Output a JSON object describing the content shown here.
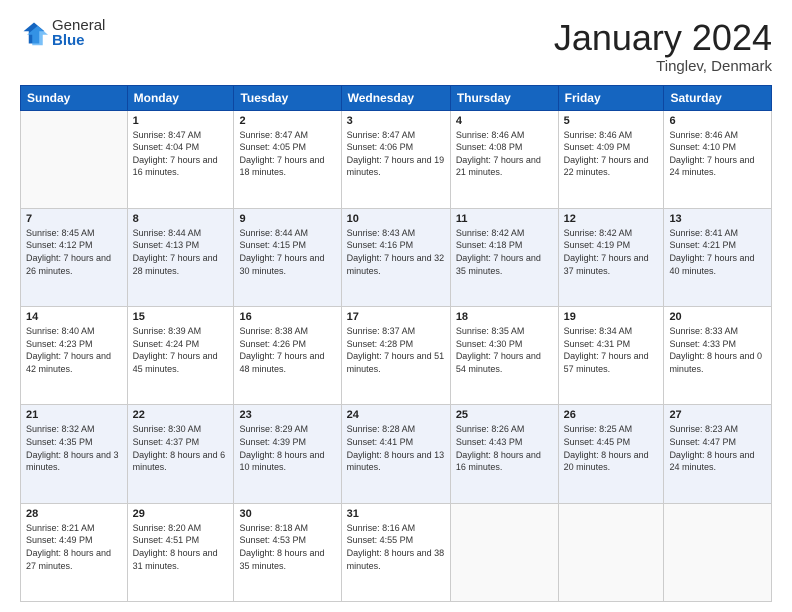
{
  "header": {
    "logo_general": "General",
    "logo_blue": "Blue",
    "title": "January 2024",
    "location": "Tinglev, Denmark"
  },
  "weekdays": [
    "Sunday",
    "Monday",
    "Tuesday",
    "Wednesday",
    "Thursday",
    "Friday",
    "Saturday"
  ],
  "weeks": [
    [
      {
        "day": null
      },
      {
        "day": 1,
        "sunrise": "Sunrise: 8:47 AM",
        "sunset": "Sunset: 4:04 PM",
        "daylight": "Daylight: 7 hours and 16 minutes."
      },
      {
        "day": 2,
        "sunrise": "Sunrise: 8:47 AM",
        "sunset": "Sunset: 4:05 PM",
        "daylight": "Daylight: 7 hours and 18 minutes."
      },
      {
        "day": 3,
        "sunrise": "Sunrise: 8:47 AM",
        "sunset": "Sunset: 4:06 PM",
        "daylight": "Daylight: 7 hours and 19 minutes."
      },
      {
        "day": 4,
        "sunrise": "Sunrise: 8:46 AM",
        "sunset": "Sunset: 4:08 PM",
        "daylight": "Daylight: 7 hours and 21 minutes."
      },
      {
        "day": 5,
        "sunrise": "Sunrise: 8:46 AM",
        "sunset": "Sunset: 4:09 PM",
        "daylight": "Daylight: 7 hours and 22 minutes."
      },
      {
        "day": 6,
        "sunrise": "Sunrise: 8:46 AM",
        "sunset": "Sunset: 4:10 PM",
        "daylight": "Daylight: 7 hours and 24 minutes."
      }
    ],
    [
      {
        "day": 7,
        "sunrise": "Sunrise: 8:45 AM",
        "sunset": "Sunset: 4:12 PM",
        "daylight": "Daylight: 7 hours and 26 minutes."
      },
      {
        "day": 8,
        "sunrise": "Sunrise: 8:44 AM",
        "sunset": "Sunset: 4:13 PM",
        "daylight": "Daylight: 7 hours and 28 minutes."
      },
      {
        "day": 9,
        "sunrise": "Sunrise: 8:44 AM",
        "sunset": "Sunset: 4:15 PM",
        "daylight": "Daylight: 7 hours and 30 minutes."
      },
      {
        "day": 10,
        "sunrise": "Sunrise: 8:43 AM",
        "sunset": "Sunset: 4:16 PM",
        "daylight": "Daylight: 7 hours and 32 minutes."
      },
      {
        "day": 11,
        "sunrise": "Sunrise: 8:42 AM",
        "sunset": "Sunset: 4:18 PM",
        "daylight": "Daylight: 7 hours and 35 minutes."
      },
      {
        "day": 12,
        "sunrise": "Sunrise: 8:42 AM",
        "sunset": "Sunset: 4:19 PM",
        "daylight": "Daylight: 7 hours and 37 minutes."
      },
      {
        "day": 13,
        "sunrise": "Sunrise: 8:41 AM",
        "sunset": "Sunset: 4:21 PM",
        "daylight": "Daylight: 7 hours and 40 minutes."
      }
    ],
    [
      {
        "day": 14,
        "sunrise": "Sunrise: 8:40 AM",
        "sunset": "Sunset: 4:23 PM",
        "daylight": "Daylight: 7 hours and 42 minutes."
      },
      {
        "day": 15,
        "sunrise": "Sunrise: 8:39 AM",
        "sunset": "Sunset: 4:24 PM",
        "daylight": "Daylight: 7 hours and 45 minutes."
      },
      {
        "day": 16,
        "sunrise": "Sunrise: 8:38 AM",
        "sunset": "Sunset: 4:26 PM",
        "daylight": "Daylight: 7 hours and 48 minutes."
      },
      {
        "day": 17,
        "sunrise": "Sunrise: 8:37 AM",
        "sunset": "Sunset: 4:28 PM",
        "daylight": "Daylight: 7 hours and 51 minutes."
      },
      {
        "day": 18,
        "sunrise": "Sunrise: 8:35 AM",
        "sunset": "Sunset: 4:30 PM",
        "daylight": "Daylight: 7 hours and 54 minutes."
      },
      {
        "day": 19,
        "sunrise": "Sunrise: 8:34 AM",
        "sunset": "Sunset: 4:31 PM",
        "daylight": "Daylight: 7 hours and 57 minutes."
      },
      {
        "day": 20,
        "sunrise": "Sunrise: 8:33 AM",
        "sunset": "Sunset: 4:33 PM",
        "daylight": "Daylight: 8 hours and 0 minutes."
      }
    ],
    [
      {
        "day": 21,
        "sunrise": "Sunrise: 8:32 AM",
        "sunset": "Sunset: 4:35 PM",
        "daylight": "Daylight: 8 hours and 3 minutes."
      },
      {
        "day": 22,
        "sunrise": "Sunrise: 8:30 AM",
        "sunset": "Sunset: 4:37 PM",
        "daylight": "Daylight: 8 hours and 6 minutes."
      },
      {
        "day": 23,
        "sunrise": "Sunrise: 8:29 AM",
        "sunset": "Sunset: 4:39 PM",
        "daylight": "Daylight: 8 hours and 10 minutes."
      },
      {
        "day": 24,
        "sunrise": "Sunrise: 8:28 AM",
        "sunset": "Sunset: 4:41 PM",
        "daylight": "Daylight: 8 hours and 13 minutes."
      },
      {
        "day": 25,
        "sunrise": "Sunrise: 8:26 AM",
        "sunset": "Sunset: 4:43 PM",
        "daylight": "Daylight: 8 hours and 16 minutes."
      },
      {
        "day": 26,
        "sunrise": "Sunrise: 8:25 AM",
        "sunset": "Sunset: 4:45 PM",
        "daylight": "Daylight: 8 hours and 20 minutes."
      },
      {
        "day": 27,
        "sunrise": "Sunrise: 8:23 AM",
        "sunset": "Sunset: 4:47 PM",
        "daylight": "Daylight: 8 hours and 24 minutes."
      }
    ],
    [
      {
        "day": 28,
        "sunrise": "Sunrise: 8:21 AM",
        "sunset": "Sunset: 4:49 PM",
        "daylight": "Daylight: 8 hours and 27 minutes."
      },
      {
        "day": 29,
        "sunrise": "Sunrise: 8:20 AM",
        "sunset": "Sunset: 4:51 PM",
        "daylight": "Daylight: 8 hours and 31 minutes."
      },
      {
        "day": 30,
        "sunrise": "Sunrise: 8:18 AM",
        "sunset": "Sunset: 4:53 PM",
        "daylight": "Daylight: 8 hours and 35 minutes."
      },
      {
        "day": 31,
        "sunrise": "Sunrise: 8:16 AM",
        "sunset": "Sunset: 4:55 PM",
        "daylight": "Daylight: 8 hours and 38 minutes."
      },
      {
        "day": null
      },
      {
        "day": null
      },
      {
        "day": null
      }
    ]
  ]
}
